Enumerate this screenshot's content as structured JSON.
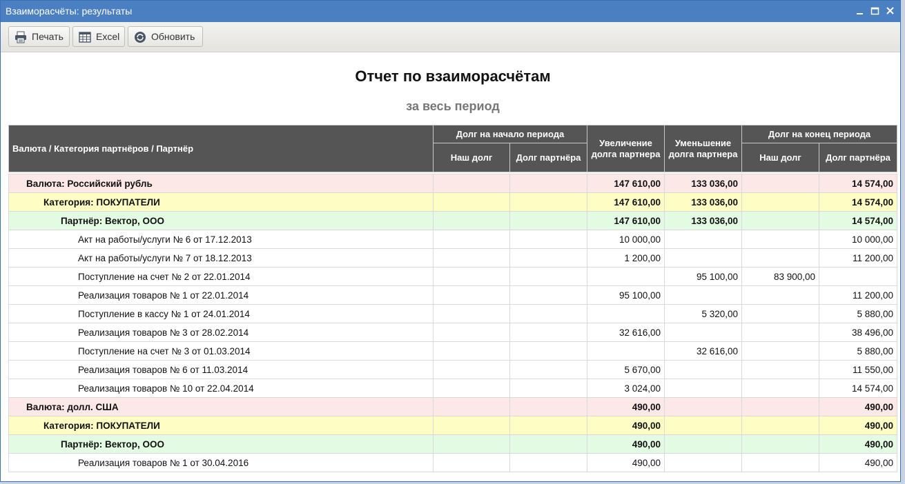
{
  "window": {
    "title": "Взаиморасчёты: результаты"
  },
  "toolbar": {
    "print_label": "Печать",
    "excel_label": "Excel",
    "refresh_label": "Обновить"
  },
  "report": {
    "title": "Отчет по взаиморасчётам",
    "subtitle": "за весь период"
  },
  "table": {
    "headers": {
      "name": "Валюта / Категория партнёров / Партнёр",
      "start_group": "Долг на начало периода",
      "start_our": "Наш долг",
      "start_partner": "Долг партнёра",
      "increase": "Увеличение долга партнера",
      "decrease": "Уменьшение долга партнера",
      "end_group": "Долг на конец периода",
      "end_our": "Наш долг",
      "end_partner": "Долг партнёра"
    },
    "rows": [
      {
        "level": 0,
        "name": "Валюта: Российский рубль",
        "start_our": "",
        "start_partner": "",
        "increase": "147 610,00",
        "decrease": "133 036,00",
        "end_our": "",
        "end_partner": "14 574,00"
      },
      {
        "level": 1,
        "name": "Категория: ПОКУПАТЕЛИ",
        "start_our": "",
        "start_partner": "",
        "increase": "147 610,00",
        "decrease": "133 036,00",
        "end_our": "",
        "end_partner": "14 574,00"
      },
      {
        "level": 2,
        "name": "Партнёр: Вектор, ООО",
        "start_our": "",
        "start_partner": "",
        "increase": "147 610,00",
        "decrease": "133 036,00",
        "end_our": "",
        "end_partner": "14 574,00"
      },
      {
        "level": 3,
        "name": "Акт на работы/услуги № 6 от 17.12.2013",
        "start_our": "",
        "start_partner": "",
        "increase": "10 000,00",
        "decrease": "",
        "end_our": "",
        "end_partner": "10 000,00"
      },
      {
        "level": 3,
        "name": "Акт на работы/услуги № 7 от 18.12.2013",
        "start_our": "",
        "start_partner": "",
        "increase": "1 200,00",
        "decrease": "",
        "end_our": "",
        "end_partner": "11 200,00"
      },
      {
        "level": 3,
        "name": "Поступление на счет № 2 от 22.01.2014",
        "start_our": "",
        "start_partner": "",
        "increase": "",
        "decrease": "95 100,00",
        "end_our": "83 900,00",
        "end_partner": ""
      },
      {
        "level": 3,
        "name": "Реализация товаров № 1 от 22.01.2014",
        "start_our": "",
        "start_partner": "",
        "increase": "95 100,00",
        "decrease": "",
        "end_our": "",
        "end_partner": "11 200,00"
      },
      {
        "level": 3,
        "name": "Поступление в кассу № 1 от 24.01.2014",
        "start_our": "",
        "start_partner": "",
        "increase": "",
        "decrease": "5 320,00",
        "end_our": "",
        "end_partner": "5 880,00"
      },
      {
        "level": 3,
        "name": "Реализация товаров № 3 от 28.02.2014",
        "start_our": "",
        "start_partner": "",
        "increase": "32 616,00",
        "decrease": "",
        "end_our": "",
        "end_partner": "38 496,00"
      },
      {
        "level": 3,
        "name": "Поступление на счет № 3 от 01.03.2014",
        "start_our": "",
        "start_partner": "",
        "increase": "",
        "decrease": "32 616,00",
        "end_our": "",
        "end_partner": "5 880,00"
      },
      {
        "level": 3,
        "name": "Реализация товаров № 6 от 11.03.2014",
        "start_our": "",
        "start_partner": "",
        "increase": "5 670,00",
        "decrease": "",
        "end_our": "",
        "end_partner": "11 550,00"
      },
      {
        "level": 3,
        "name": "Реализация товаров № 10 от 22.04.2014",
        "start_our": "",
        "start_partner": "",
        "increase": "3 024,00",
        "decrease": "",
        "end_our": "",
        "end_partner": "14 574,00"
      },
      {
        "level": 0,
        "name": "Валюта: долл. США",
        "start_our": "",
        "start_partner": "",
        "increase": "490,00",
        "decrease": "",
        "end_our": "",
        "end_partner": "490,00"
      },
      {
        "level": 1,
        "name": "Категория: ПОКУПАТЕЛИ",
        "start_our": "",
        "start_partner": "",
        "increase": "490,00",
        "decrease": "",
        "end_our": "",
        "end_partner": "490,00"
      },
      {
        "level": 2,
        "name": "Партнёр: Вектор, ООО",
        "start_our": "",
        "start_partner": "",
        "increase": "490,00",
        "decrease": "",
        "end_our": "",
        "end_partner": "490,00"
      },
      {
        "level": 3,
        "name": "Реализация товаров № 1 от 30.04.2016",
        "start_our": "",
        "start_partner": "",
        "increase": "490,00",
        "decrease": "",
        "end_our": "",
        "end_partner": "490,00"
      }
    ]
  },
  "icons": {
    "print": "printer-icon",
    "excel": "spreadsheet-icon",
    "refresh": "refresh-icon",
    "minimize": "minimize-icon",
    "maximize": "maximize-icon",
    "close": "close-icon"
  },
  "colors": {
    "titlebar": "#4a7fc1",
    "header_bg": "#555555",
    "currency_row": "#fde8e8",
    "category_row": "#fdfdc4",
    "partner_row": "#e2fbe2"
  }
}
